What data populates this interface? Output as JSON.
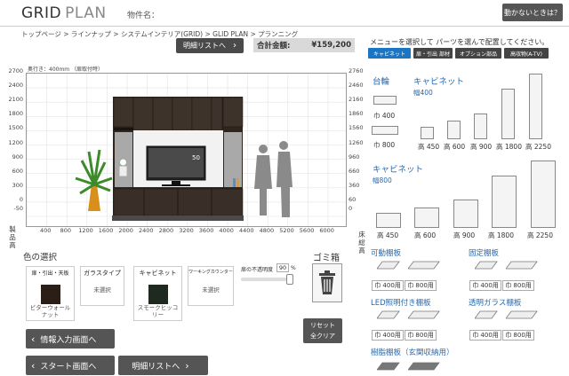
{
  "header": {
    "logo_part1": "GRID",
    "logo_part2": "PLAN",
    "property_label": "物件名：",
    "help_button": "動かないときは？"
  },
  "breadcrumb": "トップページ > ラインナップ > システムインテリア(GRID) > GLID PLAN > プランニング",
  "detail_list_button": "明細リストへ",
  "total": {
    "label": "合計金額:",
    "value": "¥159,200"
  },
  "menu_hint": "メニューを選択して パーツを選んで配置してください。",
  "tabs": [
    "キャビネット",
    "扉・引出 部材",
    "オプション部品",
    "高収物(A-TV)"
  ],
  "canvas": {
    "depth_note": "奥行き：400mm  （扉取付時）",
    "y_ticks_left": [
      "2700",
      "2400",
      "2100",
      "1800",
      "1500",
      "1200",
      "900",
      "600",
      "300",
      "0",
      "-50"
    ],
    "y_ticks_right": [
      "2760",
      "2460",
      "2160",
      "1860",
      "1560",
      "1260",
      "960",
      "660",
      "360",
      "60",
      "0"
    ],
    "x_ticks": [
      "400",
      "800",
      "1200",
      "1600",
      "2000",
      "2400",
      "2800",
      "3200",
      "3600",
      "4000",
      "4400",
      "4800",
      "5200",
      "5600",
      "6000"
    ],
    "tv_label": "50",
    "left_vertical_label": "製品高",
    "right_vertical_label": "床総高"
  },
  "color_section": {
    "title": "色の選択",
    "cards": [
      {
        "header": "扉・引出・天板",
        "footer": "ビターウォール\nナット",
        "swatch": "#2a1e16"
      },
      {
        "header": "ガラスタイプ",
        "footer": "未選択",
        "swatch": null
      },
      {
        "header": "キャビネット",
        "footer": "スモークヒッコ\nリー",
        "swatch": "#1e2a20"
      },
      {
        "header": "ワーキングカウンター",
        "footer": "未選択",
        "swatch": null
      }
    ],
    "transparency_label": "扉の不透明度",
    "transparency_value": "90",
    "transparency_unit": "%"
  },
  "trash_label": "ゴミ箱",
  "reset_button": {
    "line1": "リセット",
    "line2": "全クリア"
  },
  "nav_buttons": {
    "info_input": "情報入力画面へ",
    "start": "スタート画面へ",
    "detail_list": "明細リストへ"
  },
  "catalog": {
    "base": {
      "title": "台輪",
      "items": [
        "巾 400",
        "巾 800"
      ]
    },
    "cabinet400": {
      "title": "キャビネット",
      "subtitle": "幅400",
      "items": [
        "高 450",
        "高 600",
        "高 900",
        "高 1800",
        "高 2250"
      ]
    },
    "cabinet800": {
      "title": "キャビネット",
      "subtitle": "幅800",
      "items": [
        "高 450",
        "高 600",
        "高 900",
        "高 1800",
        "高 2250"
      ]
    },
    "shelves": [
      {
        "title": "可動棚板",
        "items": [
          "巾 400用",
          "巾 800用"
        ]
      },
      {
        "title": "固定棚板",
        "items": [
          "巾 400用",
          "巾 800用"
        ]
      },
      {
        "title": "LED照明付き棚板",
        "items": [
          "巾 400用",
          "巾 800用"
        ]
      },
      {
        "title": "透明ガラス棚板",
        "items": [
          "巾 400用",
          "巾 800用"
        ]
      },
      {
        "title": "樹脂棚板（玄関収納用）",
        "items": []
      }
    ]
  }
}
